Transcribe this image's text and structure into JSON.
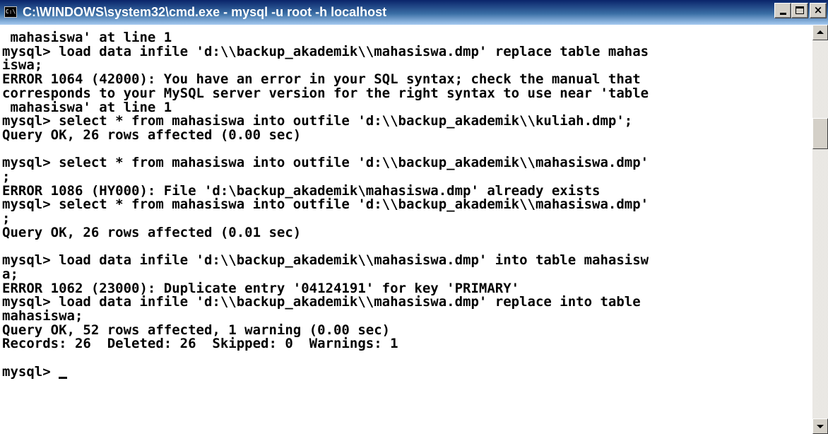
{
  "window": {
    "title": "C:\\WINDOWS\\system32\\cmd.exe - mysql -u root -h localhost",
    "icon": "cmd-console-icon",
    "icon_text": "C:\\",
    "controls": [
      "minimize",
      "maximize",
      "close"
    ],
    "close_label": "×"
  },
  "console": {
    "foreground": "#000000",
    "background": "#ffffff",
    "lines": [
      " mahasiswa' at line 1",
      "mysql> load data infile 'd:\\\\backup_akademik\\\\mahasiswa.dmp' replace table mahas",
      "iswa;",
      "ERROR 1064 (42000): You have an error in your SQL syntax; check the manual that",
      "corresponds to your MySQL server version for the right syntax to use near 'table",
      " mahasiswa' at line 1",
      "mysql> select * from mahasiswa into outfile 'd:\\\\backup_akademik\\\\kuliah.dmp';",
      "Query OK, 26 rows affected (0.00 sec)",
      "",
      "mysql> select * from mahasiswa into outfile 'd:\\\\backup_akademik\\\\mahasiswa.dmp'",
      ";",
      "ERROR 1086 (HY000): File 'd:\\backup_akademik\\mahasiswa.dmp' already exists",
      "mysql> select * from mahasiswa into outfile 'd:\\\\backup_akademik\\\\mahasiswa.dmp'",
      ";",
      "Query OK, 26 rows affected (0.01 sec)",
      "",
      "mysql> load data infile 'd:\\\\backup_akademik\\\\mahasiswa.dmp' into table mahasisw",
      "a;",
      "ERROR 1062 (23000): Duplicate entry '04124191' for key 'PRIMARY'",
      "mysql> load data infile 'd:\\\\backup_akademik\\\\mahasiswa.dmp' replace into table",
      "mahasiswa;",
      "Query OK, 52 rows affected, 1 warning (0.00 sec)",
      "Records: 26  Deleted: 26  Skipped: 0  Warnings: 1",
      ""
    ],
    "prompt": "mysql> "
  }
}
